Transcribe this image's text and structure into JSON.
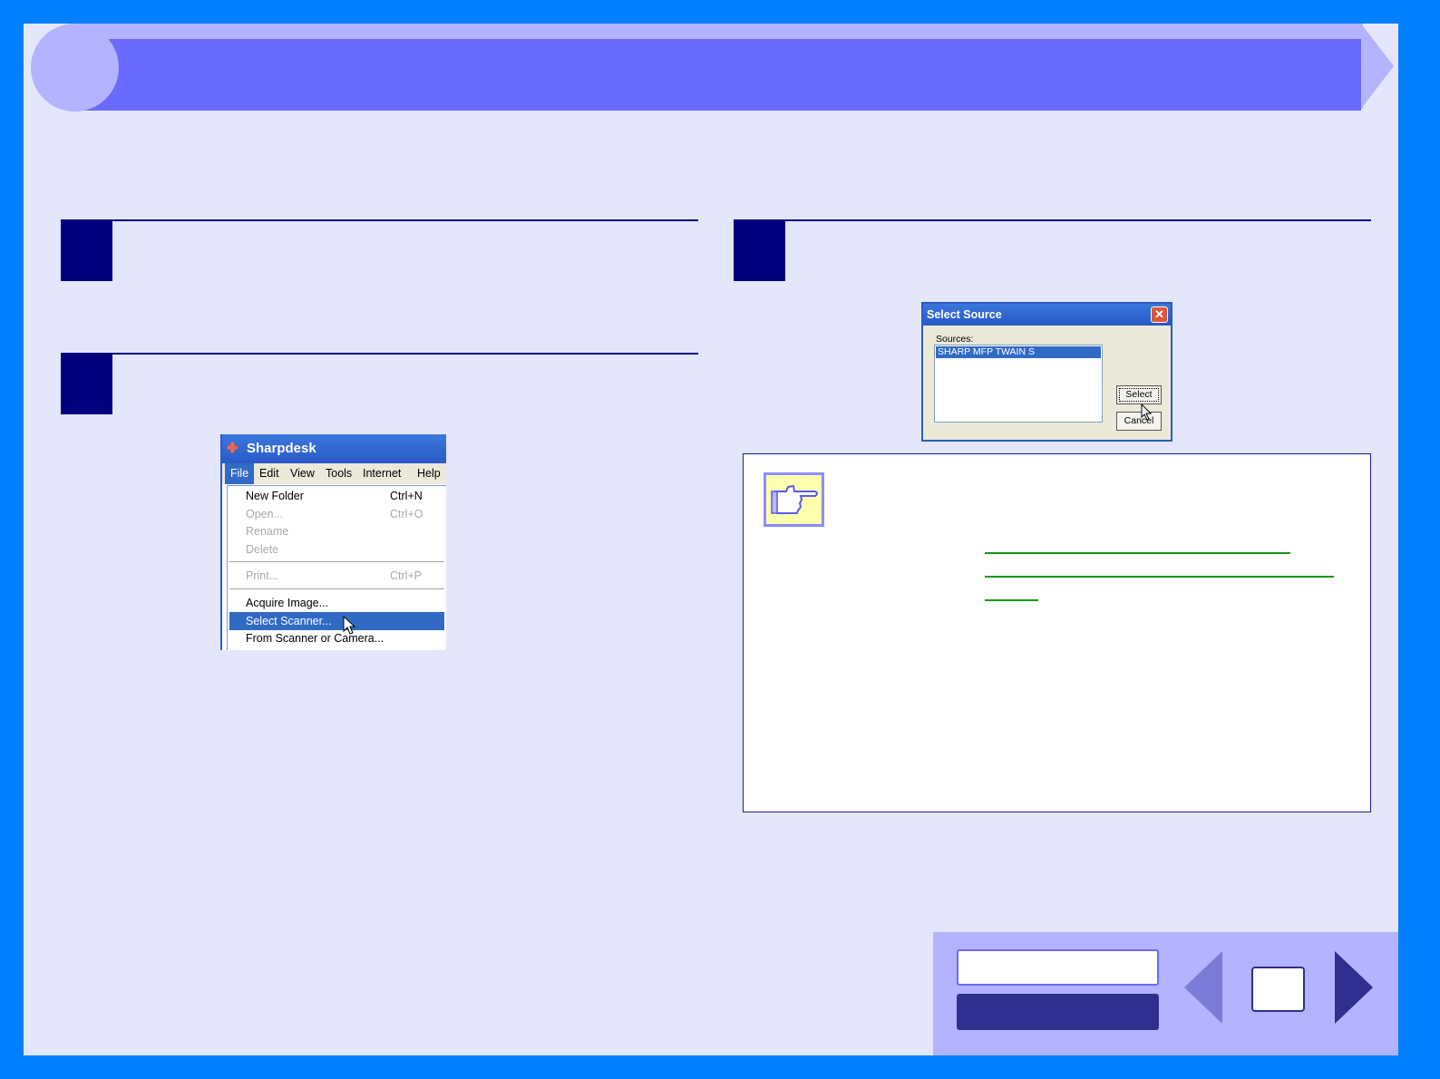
{
  "sharpdesk_window": {
    "title": "Sharpdesk",
    "menubar": [
      "File",
      "Edit",
      "View",
      "Tools",
      "Internet",
      "Help"
    ],
    "file_menu": {
      "new_folder": {
        "label": "New Folder",
        "shortcut": "Ctrl+N"
      },
      "open": {
        "label": "Open...",
        "shortcut": "Ctrl+O"
      },
      "rename": {
        "label": "Rename"
      },
      "delete": {
        "label": "Delete"
      },
      "print": {
        "label": "Print...",
        "shortcut": "Ctrl+P"
      },
      "acquire_image": {
        "label": "Acquire Image..."
      },
      "select_scanner": {
        "label": "Select Scanner..."
      },
      "from_scanner": {
        "label": "From Scanner or Camera..."
      }
    }
  },
  "select_source_dialog": {
    "title": "Select Source",
    "close_glyph": "✕",
    "sources_label": "Sources:",
    "sources": [
      "SHARP MFP TWAIN S"
    ],
    "select_button": "Select",
    "cancel_button": "Cancel"
  },
  "colors": {
    "frame": "#0080ff",
    "page": "#e4e6fb",
    "banner": "#6a6aff",
    "step_marker": "#00007f",
    "link_underline": "#0f9a0f"
  }
}
